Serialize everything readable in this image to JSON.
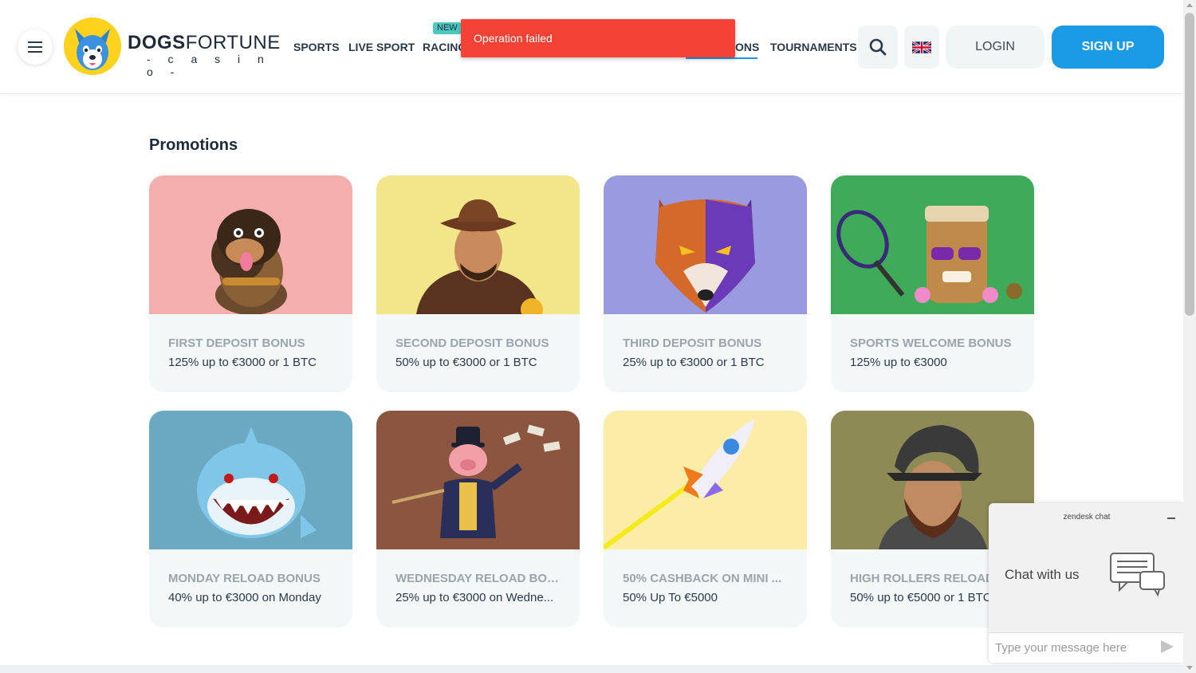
{
  "header": {
    "logo": {
      "brand_bold": "DOGS",
      "brand_light": "FORTUNE",
      "tagline": "- c a s i n o -"
    },
    "nav": [
      {
        "label": "SPORTS"
      },
      {
        "label": "LIVE SPORT"
      },
      {
        "label": "RACING"
      },
      {
        "label": "ONS"
      },
      {
        "label": "TOURNAMENTS"
      }
    ],
    "new_badge": "NEW",
    "login_label": "LOGIN",
    "signup_label": "SIGN UP",
    "search_icon": "search-icon",
    "language_icon": "uk-flag-icon"
  },
  "toast": {
    "message": "Operation failed"
  },
  "main": {
    "title": "Promotions",
    "promotions": [
      {
        "title": "FIRST DEPOSIT BONUS",
        "subtitle": "125% up to €3000 or 1 BTC",
        "bg": "#f5aeae",
        "art": "rottweiler"
      },
      {
        "title": "SECOND DEPOSIT BONUS",
        "subtitle": "50% up to €3000 or 1 BTC",
        "bg": "#f3e58a",
        "art": "cowboy"
      },
      {
        "title": "THIRD DEPOSIT BONUS",
        "subtitle": "25% up to €3000 or 1 BTC",
        "bg": "#9a9ae0",
        "art": "wolf"
      },
      {
        "title": "SPORTS WELCOME BONUS",
        "subtitle": "125% up to €3000",
        "bg": "#3faa58",
        "art": "tiki-tennis"
      },
      {
        "title": "MONDAY RELOAD BONUS",
        "subtitle": "40% up to €3000 on Monday",
        "bg": "#6aa9c1",
        "art": "shark"
      },
      {
        "title": "WEDNESDAY RELOAD BON...",
        "subtitle": "25% up to €3000 on Wedne...",
        "bg": "#8b5540",
        "art": "pig-banker"
      },
      {
        "title": "50% CASHBACK ON MINI ...",
        "subtitle": "50% Up To €5000",
        "bg": "#fbeca8",
        "art": "rocket"
      },
      {
        "title": "HIGH ROLLERS RELOAD",
        "subtitle": "50% up to €5000 or 1 BTC",
        "bg": "#8e8a55",
        "art": "conquistador"
      }
    ]
  },
  "chat": {
    "brand": "zendesk chat",
    "prompt": "Chat with us",
    "input_placeholder": "Type your message here"
  }
}
